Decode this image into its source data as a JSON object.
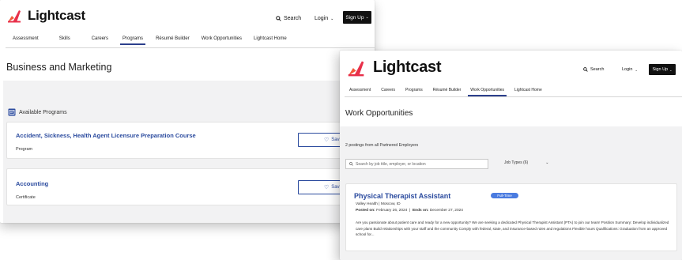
{
  "brand": {
    "name": "Lightcast",
    "colors": {
      "logo_red": "#e8304a",
      "logo_orange": "#f25a3a",
      "accent_blue": "#2a4a9e",
      "badge_blue": "#4a7be0",
      "signup_bg": "#111111"
    }
  },
  "header": {
    "search_label": "Search",
    "search_icon": "search-icon",
    "login_label": "Login",
    "signup_label": "Sign Up"
  },
  "nav": {
    "back_items": [
      "Assessment",
      "Skills",
      "Careers",
      "Programs",
      "Résumé Builder",
      "Work Opportunities",
      "Lightcast Home"
    ],
    "back_active": "Programs",
    "front_items": [
      "Assessment",
      "Careers",
      "Programs",
      "Résumé Builder",
      "Work Opportunities",
      "Lightcast Home"
    ],
    "front_active": "Work Opportunities"
  },
  "back_window": {
    "page_title": "Business and Marketing",
    "section_label": "Available Programs",
    "programs": [
      {
        "title": "Accident, Sickness, Health Agent Licensure Preparation Course",
        "type": "Program",
        "save_label": "Sav"
      },
      {
        "title": "Accounting",
        "type": "Certificate",
        "save_label": "Sav"
      }
    ]
  },
  "front_window": {
    "page_title": "Work Opportunities",
    "postings_count_text": "2 postings from all Partnered Employers",
    "search_placeholder": "Search by job title, employer, or location",
    "job_types_label": "Job Types (6)",
    "job": {
      "title": "Physical Therapist Assistant",
      "badge": "Full-Time",
      "employer_location": "Valley Health  |  Moscow, ID",
      "posted_label": "Posted on:",
      "posted_date": "February 26, 2024",
      "ends_label": "Ends on:",
      "ends_date": "December 27, 2024",
      "description": "Are you passionate about patient care and ready for a new opportunity? We are seeking a dedicated Physical Therapist Assistant (PTA) to join our team! Position Summary: Develop individualized care plans Build relationships with your staff and the community Comply with federal, state, and insurance-based rules and regulations Flexible hours Qualifications: Graduation from an approved school for..."
    }
  }
}
